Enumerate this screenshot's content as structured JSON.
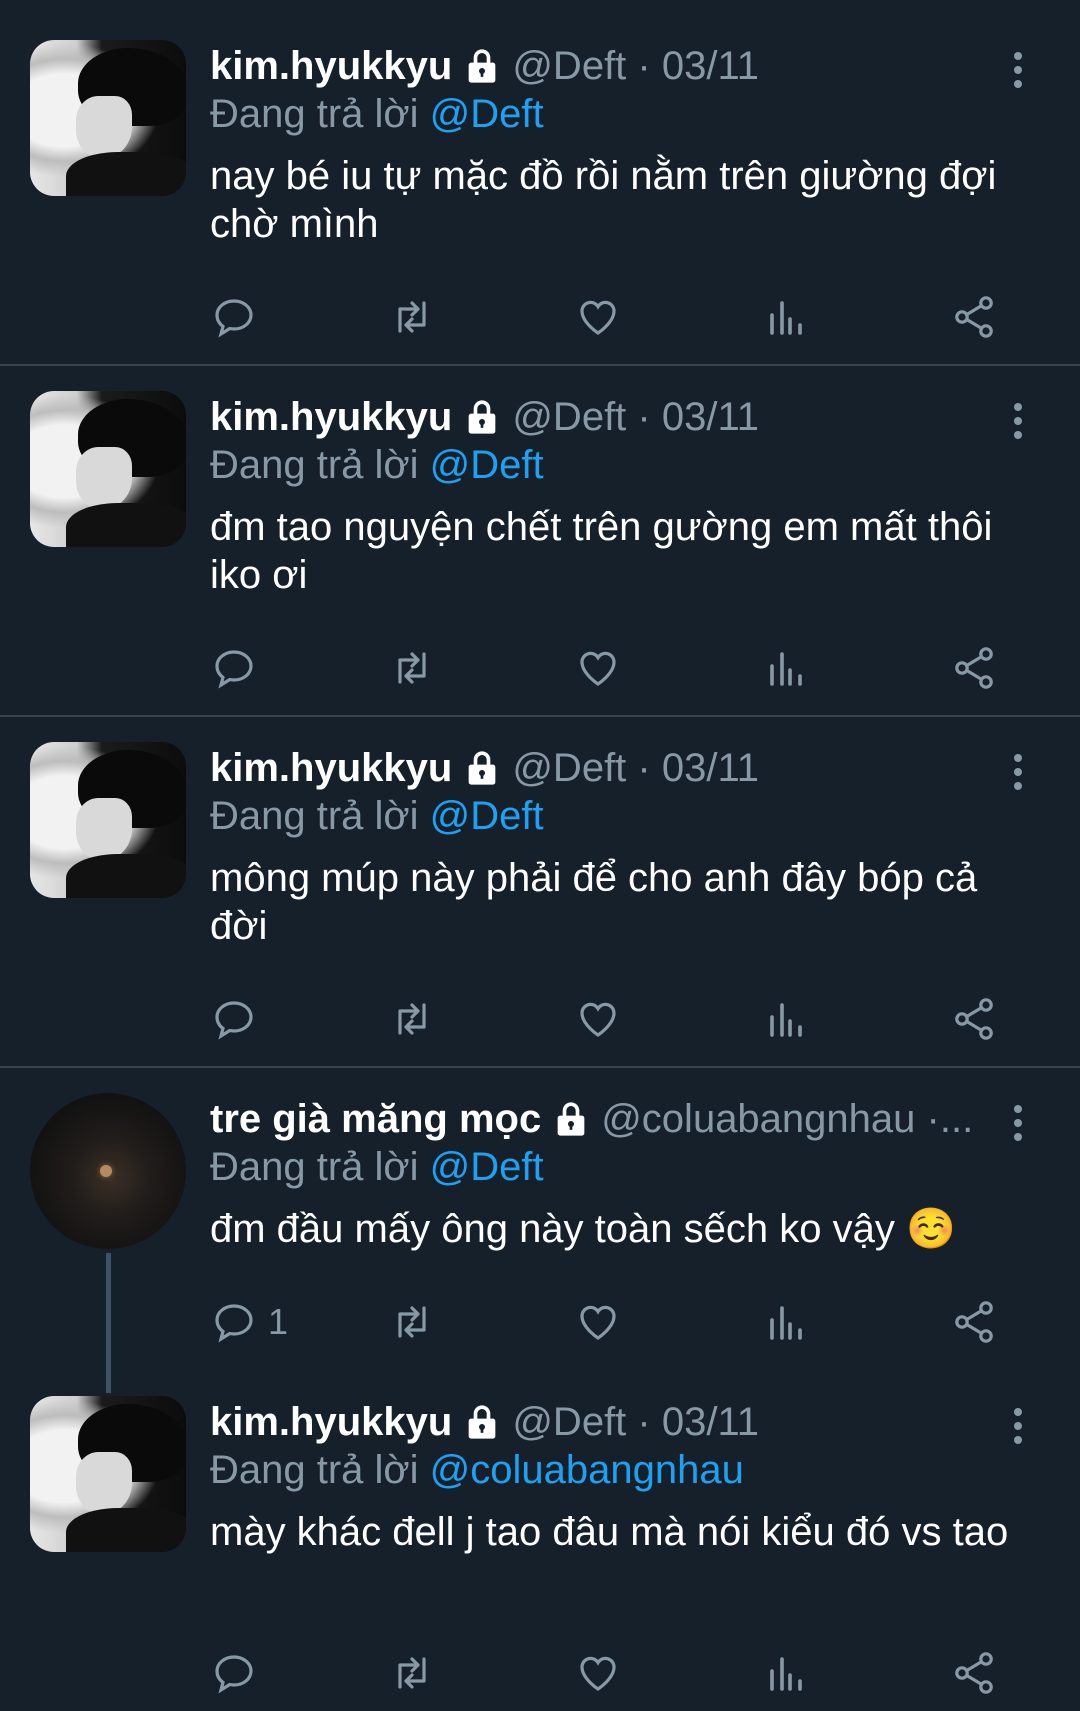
{
  "colors": {
    "background": "#15202b",
    "secondary_text": "#8899a6",
    "mention": "#1da1f2",
    "divider": "#38444d"
  },
  "replying_label": "Đang trả lời",
  "tweets": [
    {
      "name": "kim.hyukkyu",
      "handle": "@Deft · 03/11",
      "reply_to": "@Deft",
      "text": "nay bé iu tự mặc đồ rồi nằm trên giường đợi chờ mình",
      "reply_count": ""
    },
    {
      "name": "kim.hyukkyu",
      "handle": "@Deft · 03/11",
      "reply_to": "@Deft",
      "text": "đm tao nguyện chết trên gường em mất thôi iko ơi",
      "reply_count": ""
    },
    {
      "name": "kim.hyukkyu",
      "handle": "@Deft · 03/11",
      "reply_to": "@Deft",
      "text": "mông múp này phải để cho anh đây bóp cả đời",
      "reply_count": ""
    },
    {
      "name": "tre già măng mọc",
      "handle": "@coluabangnhau ·...",
      "reply_to": "@Deft",
      "text": "đm đầu mấy ông này toàn sếch ko vậy ☺️",
      "reply_count": "1"
    },
    {
      "name": "kim.hyukkyu",
      "handle": "@Deft · 03/11",
      "reply_to": "@coluabangnhau",
      "text": "mày khác đell j tao đâu mà nói kiểu đó vs tao",
      "reply_count": ""
    }
  ],
  "icons": {
    "lock": "lock-icon",
    "more": "more-vertical-icon",
    "reply": "reply-icon",
    "retweet": "retweet-icon",
    "like": "heart-icon",
    "analytics": "analytics-icon",
    "share": "share-icon"
  }
}
